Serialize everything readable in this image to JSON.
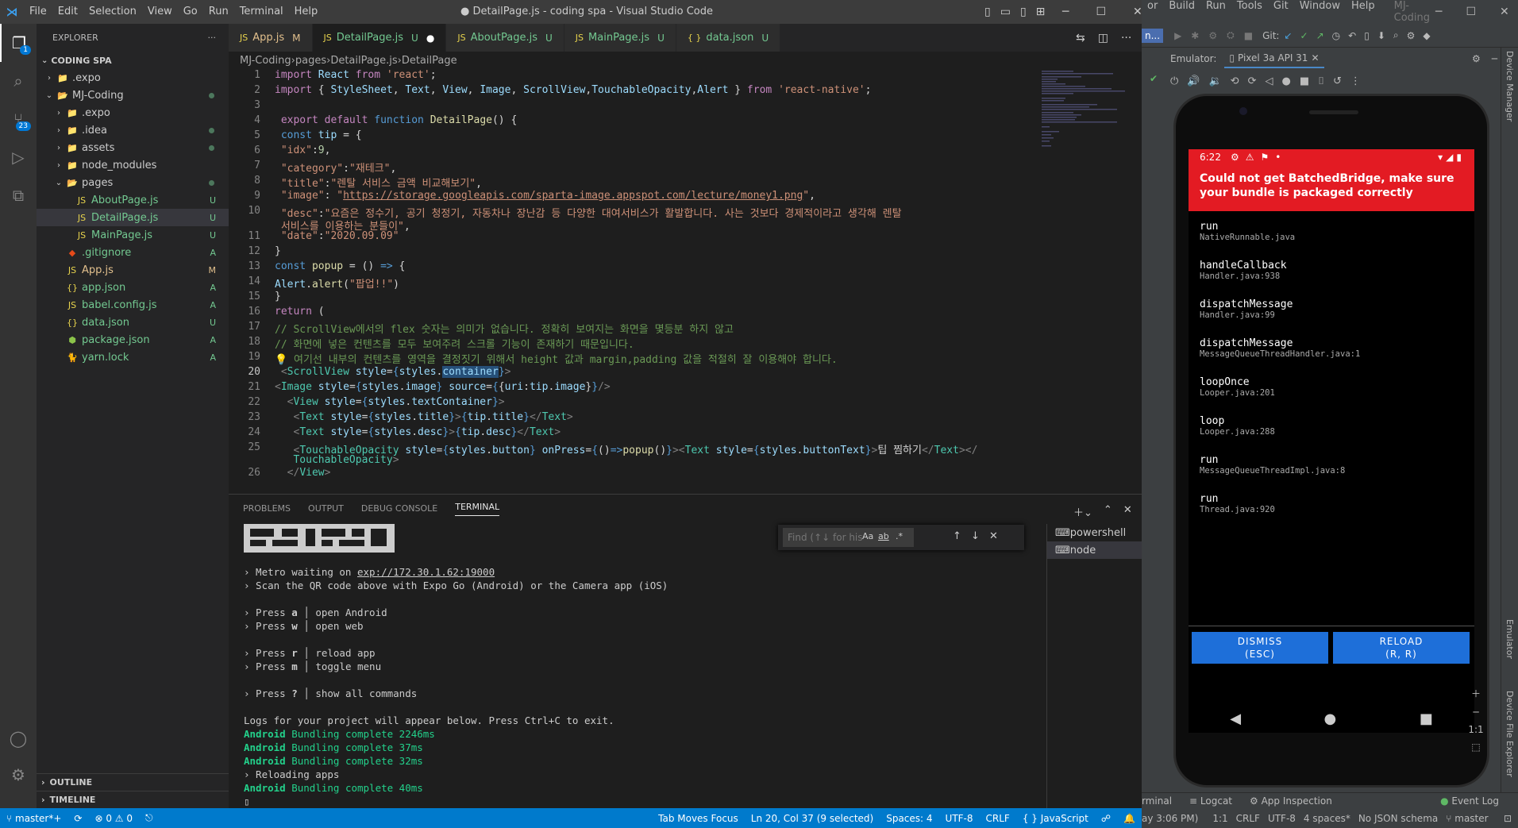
{
  "vscode": {
    "title": "● DetailPage.js - coding spa - Visual Studio Code",
    "menu": [
      "File",
      "Edit",
      "Selection",
      "View",
      "Go",
      "Run",
      "Terminal",
      "Help"
    ],
    "explorer_label": "EXPLORER",
    "project": "CODING SPA",
    "tree": [
      {
        "name": ".expo",
        "type": "folder",
        "depth": 1,
        "status": ""
      },
      {
        "name": "MJ-Coding",
        "type": "folder-open",
        "depth": 1,
        "status": "dot"
      },
      {
        "name": ".expo",
        "type": "folder",
        "depth": 2,
        "status": ""
      },
      {
        "name": ".idea",
        "type": "folder",
        "depth": 2,
        "status": "dot"
      },
      {
        "name": "assets",
        "type": "folder",
        "depth": 2,
        "status": "dot"
      },
      {
        "name": "node_modules",
        "type": "folder",
        "depth": 2,
        "status": ""
      },
      {
        "name": "pages",
        "type": "folder-open",
        "depth": 2,
        "status": "dot"
      },
      {
        "name": "AboutPage.js",
        "type": "js",
        "depth": 3,
        "status": "U"
      },
      {
        "name": "DetailPage.js",
        "type": "js",
        "depth": 3,
        "status": "U",
        "selected": true
      },
      {
        "name": "MainPage.js",
        "type": "js",
        "depth": 3,
        "status": "U"
      },
      {
        "name": ".gitignore",
        "type": "git",
        "depth": 2,
        "status": "A"
      },
      {
        "name": "App.js",
        "type": "js",
        "depth": 2,
        "status": "M"
      },
      {
        "name": "app.json",
        "type": "json",
        "depth": 2,
        "status": "A"
      },
      {
        "name": "babel.config.js",
        "type": "js",
        "depth": 2,
        "status": "A"
      },
      {
        "name": "data.json",
        "type": "json",
        "depth": 2,
        "status": "U"
      },
      {
        "name": "package.json",
        "type": "pkg",
        "depth": 2,
        "status": "A"
      },
      {
        "name": "yarn.lock",
        "type": "yarn",
        "depth": 2,
        "status": "A"
      }
    ],
    "outline_label": "OUTLINE",
    "timeline_label": "TIMELINE",
    "tabs": [
      {
        "label": "App.js",
        "status": "M",
        "icon": "JS"
      },
      {
        "label": "DetailPage.js",
        "status": "U",
        "icon": "JS",
        "active": true,
        "dirty": "●"
      },
      {
        "label": "AboutPage.js",
        "status": "U",
        "icon": "JS"
      },
      {
        "label": "MainPage.js",
        "status": "U",
        "icon": "JS"
      },
      {
        "label": "data.json",
        "status": "U",
        "icon": "{ }"
      }
    ],
    "breadcrumb": [
      "MJ-Coding",
      "pages",
      "DetailPage.js",
      "DetailPage"
    ],
    "code_lines": [
      {
        "n": "1",
        "html": "<span class='pur'>import</span> <span class='var'>React</span> <span class='pur'>from</span> <span class='str'>'react'</span>;"
      },
      {
        "n": "2",
        "html": "<span class='pur'>import</span> { <span class='var'>StyleSheet</span>, <span class='var'>Text</span>, <span class='var'>View</span>, <span class='var'>Image</span>, <span class='var'>ScrollView</span>,<span class='var'>TouchableOpacity</span>,<span class='var'>Alert</span> } <span class='pur'>from</span> <span class='str'>'react-native'</span>;"
      },
      {
        "n": "3",
        "html": ""
      },
      {
        "n": "4",
        "html": " <span class='pur'>export</span> <span class='pur'>default</span> <span class='kw'>function</span> <span class='fn'>DetailPage</span>() {"
      },
      {
        "n": "5",
        "html": " <span class='kw'>const</span> <span class='var'>tip</span> = {"
      },
      {
        "n": "6",
        "html": " <span class='str'>\"idx\"</span>:<span class='num'>9</span>,"
      },
      {
        "n": "7",
        "html": " <span class='str'>\"category\"</span>:<span class='str'>\"재테크\"</span>,"
      },
      {
        "n": "8",
        "html": " <span class='str'>\"title\"</span>:<span class='str'>\"렌탈 서비스 금액 비교해보기\"</span>,"
      },
      {
        "n": "9",
        "html": " <span class='str'>\"image\"</span>: <span class='str'>\"<u>https://storage.googleapis.com/sparta-image.appspot.com/lecture/money1.png</u>\"</span>,"
      },
      {
        "n": "10",
        "html": " <span class='str'>\"desc\"</span>:<span class='str'>\"요즘은 정수기, 공기 청정기, 자동차나 장난감 등 다양한 대여서비스가 활발합니다. 사는 것보다 경제적이라고 생각해 렌탈</span>"
      },
      {
        "n": "",
        "html": " <span class='str'>서비스를 이용하는 분들이\"</span>,"
      },
      {
        "n": "11",
        "html": " <span class='str'>\"date\"</span>:<span class='str'>\"2020.09.09\"</span>"
      },
      {
        "n": "12",
        "html": "}"
      },
      {
        "n": "13",
        "html": "<span class='kw'>const</span> <span class='fn'>popup</span> = () <span class='kw'>=&gt;</span> {"
      },
      {
        "n": "14",
        "html": "<span class='var'>Alert</span>.<span class='fn'>alert</span>(<span class='str'>\"팝업!!\"</span>)"
      },
      {
        "n": "15",
        "html": "}"
      },
      {
        "n": "16",
        "html": "<span class='pur'>return</span> ("
      },
      {
        "n": "17",
        "html": "<span class='cm'>// ScrollView에서의 flex 숫자는 의미가 없습니다. 정확히 보여지는 화면을 몇등분 하지 않고</span>"
      },
      {
        "n": "18",
        "html": "<span class='cm'>// 화면에 넣은 컨텐츠를 모두 보여주려 스크롤 기능이 존재하기 때문입니다.</span>"
      },
      {
        "n": "19",
        "html": "<span class='cm'>💡 여기선 내부의 컨텐츠를 영역을 결정짓기 위해서 height 값과 margin,padding 값을 적절히 잘 이용해야 합니다.</span>"
      },
      {
        "n": "20",
        "html": " <span style='color:#808080'>&lt;</span><span class='tag'>ScrollView</span> <span class='var'>style</span>=<span class='kw'>{</span><span class='var'>styles</span>.<span class='var' style='background:#264f78'>container</span><span class='kw'>}</span><span style='color:#808080'>&gt;</span>",
        "cur": true
      },
      {
        "n": "21",
        "html": "<span style='color:#808080'>&lt;</span><span class='tag'>Image</span> <span class='var'>style</span>=<span class='kw'>{</span><span class='var'>styles</span>.<span class='var'>image</span><span class='kw'>}</span> <span class='var'>source</span>=<span class='kw'>{</span>{<span class='var'>uri</span>:<span class='var'>tip</span>.<span class='var'>image</span>}<span class='kw'>}</span><span style='color:#808080'>/&gt;</span>"
      },
      {
        "n": "22",
        "html": "  <span style='color:#808080'>&lt;</span><span class='tag'>View</span> <span class='var'>style</span>=<span class='kw'>{</span><span class='var'>styles</span>.<span class='var'>textContainer</span><span class='kw'>}</span><span style='color:#808080'>&gt;</span>"
      },
      {
        "n": "23",
        "html": "   <span style='color:#808080'>&lt;</span><span class='tag'>Text</span> <span class='var'>style</span>=<span class='kw'>{</span><span class='var'>styles</span>.<span class='var'>title</span><span class='kw'>}</span><span style='color:#808080'>&gt;</span><span class='kw'>{</span><span class='var'>tip</span>.<span class='var'>title</span><span class='kw'>}</span><span style='color:#808080'>&lt;/</span><span class='tag'>Text</span><span style='color:#808080'>&gt;</span>"
      },
      {
        "n": "24",
        "html": "   <span style='color:#808080'>&lt;</span><span class='tag'>Text</span> <span class='var'>style</span>=<span class='kw'>{</span><span class='var'>styles</span>.<span class='var'>desc</span><span class='kw'>}</span><span style='color:#808080'>&gt;</span><span class='kw'>{</span><span class='var'>tip</span>.<span class='var'>desc</span><span class='kw'>}</span><span style='color:#808080'>&lt;/</span><span class='tag'>Text</span><span style='color:#808080'>&gt;</span>"
      },
      {
        "n": "25",
        "html": "   <span style='color:#808080'>&lt;</span><span class='tag'>TouchableOpacity</span> <span class='var'>style</span>=<span class='kw'>{</span><span class='var'>styles</span>.<span class='var'>button</span><span class='kw'>}</span> <span class='var'>onPress</span>=<span class='kw'>{</span>()<span class='kw'>=&gt;</span><span class='fn'>popup</span>()<span class='kw'>}</span><span style='color:#808080'>&gt;&lt;</span><span class='tag'>Text</span> <span class='var'>style</span>=<span class='kw'>{</span><span class='var'>styles</span>.<span class='var'>buttonText</span><span class='kw'>}</span><span style='color:#808080'>&gt;</span>팁 찜하기<span style='color:#808080'>&lt;/</span><span class='tag'>Text</span><span style='color:#808080'>&gt;&lt;/</span>"
      },
      {
        "n": "",
        "html": "   <span class='tag'>TouchableOpacity</span><span style='color:#808080'>&gt;</span>"
      },
      {
        "n": "26",
        "html": "  <span style='color:#808080'>&lt;/</span><span class='tag'>View</span><span style='color:#808080'>&gt;</span>"
      }
    ],
    "panel_tabs": [
      "PROBLEMS",
      "OUTPUT",
      "DEBUG CONSOLE",
      "TERMINAL"
    ],
    "terminal_lines": [
      {
        "t": "",
        "html": ""
      },
      {
        "t": "",
        "html": "› Metro waiting on <span class='ul'>exp://172.30.1.62:19000</span>"
      },
      {
        "t": "",
        "html": "› Scan the QR code above with Expo Go (Android) or the Camera app (iOS)"
      },
      {
        "t": "",
        "html": ""
      },
      {
        "t": "",
        "html": "› Press <b>a</b> │ open Android"
      },
      {
        "t": "",
        "html": "› Press <b>w</b> │ open web"
      },
      {
        "t": "",
        "html": ""
      },
      {
        "t": "",
        "html": "› Press <b>r</b> │ reload app"
      },
      {
        "t": "",
        "html": "› Press <b>m</b> │ toggle menu"
      },
      {
        "t": "",
        "html": ""
      },
      {
        "t": "",
        "html": "› Press <b>?</b> │ show all commands"
      },
      {
        "t": "",
        "html": ""
      },
      {
        "t": "",
        "html": "Logs for your project will appear below. Press Ctrl+C to exit."
      },
      {
        "t": "",
        "html": "<span class='green'>Android</span> <span style='color:#23d18b'>Bundling complete 2246ms</span>"
      },
      {
        "t": "",
        "html": "<span class='green'>Android</span> <span style='color:#23d18b'>Bundling complete 37ms</span>"
      },
      {
        "t": "",
        "html": "<span class='green'>Android</span> <span style='color:#23d18b'>Bundling complete 32ms</span>"
      },
      {
        "t": "",
        "html": "› Reloading apps"
      },
      {
        "t": "",
        "html": "<span class='green'>Android</span> <span style='color:#23d18b'>Bundling complete 40ms</span>"
      },
      {
        "t": "",
        "html": "▯"
      }
    ],
    "terminals": [
      "powershell",
      "node"
    ],
    "find_placeholder": "Find (↑↓ for his",
    "status": {
      "branch": "master*+",
      "sync": "⟳",
      "errors": "⊗ 0 ⚠ 0",
      "tab_moves": "Tab Moves Focus",
      "position": "Ln 20, Col 37 (9 selected)",
      "spaces": "Spaces: 4",
      "encoding": "UTF-8",
      "eol": "CRLF",
      "language": "{ } JavaScript"
    }
  },
  "android_studio": {
    "menu": [
      "or",
      "Build",
      "Run",
      "Tools",
      "Git",
      "Window",
      "Help",
      "MJ-Coding"
    ],
    "git_label": "Git:",
    "emulator_label": "Emulator:",
    "device": "Pixel 3a API 31",
    "phone": {
      "time": "6:22",
      "error_title": "Could not get BatchedBridge, make sure your bundle is packaged correctly",
      "frames": [
        {
          "name": "run",
          "src": "NativeRunnable.java"
        },
        {
          "name": "handleCallback",
          "src": "Handler.java:938"
        },
        {
          "name": "dispatchMessage",
          "src": "Handler.java:99"
        },
        {
          "name": "dispatchMessage",
          "src": "MessageQueueThreadHandler.java:1"
        },
        {
          "name": "loopOnce",
          "src": "Looper.java:201"
        },
        {
          "name": "loop",
          "src": "Looper.java:288"
        },
        {
          "name": "run",
          "src": "MessageQueueThreadImpl.java:8"
        },
        {
          "name": "run",
          "src": "Thread.java:920"
        }
      ],
      "dismiss_label": "DISMISS",
      "dismiss_sub": "(ESC)",
      "reload_label": "RELOAD",
      "reload_sub": "(R, R)"
    },
    "bottom_tabs": [
      "rminal",
      "Logcat",
      "App Inspection",
      "Event Log"
    ],
    "status_items": [
      "ay 3:06 PM)",
      "1:1",
      "CRLF",
      "UTF-8",
      "4 spaces*",
      "No JSON schema",
      "master"
    ],
    "side_labels": [
      "Device Manager",
      "Emulator",
      "Device File Explorer"
    ],
    "zoom_label": "1:1"
  }
}
